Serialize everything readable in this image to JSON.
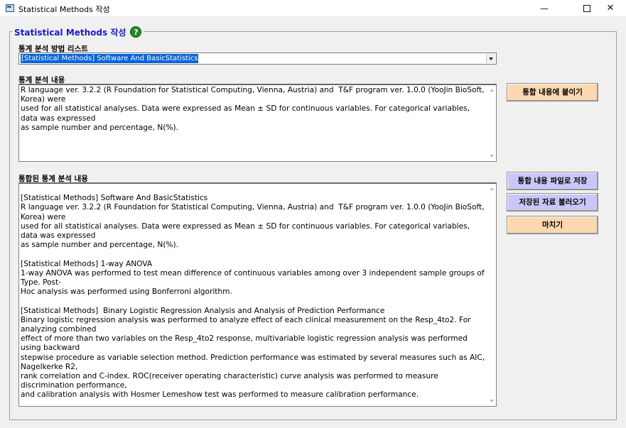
{
  "window": {
    "title": "Statistical Methods 작성",
    "minimize": "—",
    "close": "✕"
  },
  "group": {
    "title": "Statistical Methods 작성",
    "help": "?"
  },
  "method_list": {
    "label": "통계 분석 방법 리스트",
    "selected": "[Statistical Methods] Software And BasicStatistics"
  },
  "content": {
    "label": "통계 분석 내용",
    "text": "R language ver. 3.2.2 (R Foundation for Statistical Computing, Vienna, Austria) and  T&F program ver. 1.0.0 (YooJin BioSoft, Korea) were\nused for all statistical analyses. Data were expressed as Mean ± SD for continuous variables. For categorical variables, data was expressed\nas sample number and percentage, N(%)."
  },
  "combined": {
    "label": "통합된 통계 분석 내용",
    "text": "\n[Statistical Methods] Software And BasicStatistics\nR language ver. 3.2.2 (R Foundation for Statistical Computing, Vienna, Austria) and  T&F program ver. 1.0.0 (YooJin BioSoft, Korea) were\nused for all statistical analyses. Data were expressed as Mean ± SD for continuous variables. For categorical variables, data was expressed\nas sample number and percentage, N(%).\n\n[Statistical Methods] 1-way ANOVA\n1-way ANOVA was performed to test mean difference of continuous variables among over 3 independent sample groups of Type. Post-\nHoc analysis was performed using Bonferroni algorithm.\n\n[Statistical Methods]  Binary Logistic Regression Analysis and Analysis of Prediction Performance\nBinary logistic regression analysis was performed to analyze effect of each clinical measurement on the Resp_4to2. For analyzing combined\neffect of more than two variables on the Resp_4to2 response, multivariable logistic regression analysis was performed using backward\nstepwise procedure as variable selection method. Prediction performance was estimated by several measures such as AIC, Nagelkerke R2,\nrank correlation and C-index. ROC(receiver operating characteristic) curve analysis was performed to measure discrimination performance,\nand calibration analysis with Hosmer Lemeshow test was performed to measure calibration performance."
  },
  "buttons": {
    "paste": "통합 내용에 붙이기",
    "save_file": "통합 내용 파일로 저장",
    "load": "저장된 자료 불러오기",
    "finish": "마치기"
  },
  "colors": {
    "title_blue": "#1a1ac8",
    "peach": "#fbd8b0",
    "lavender": "#c8c8f8",
    "selection": "#0a64d8"
  }
}
